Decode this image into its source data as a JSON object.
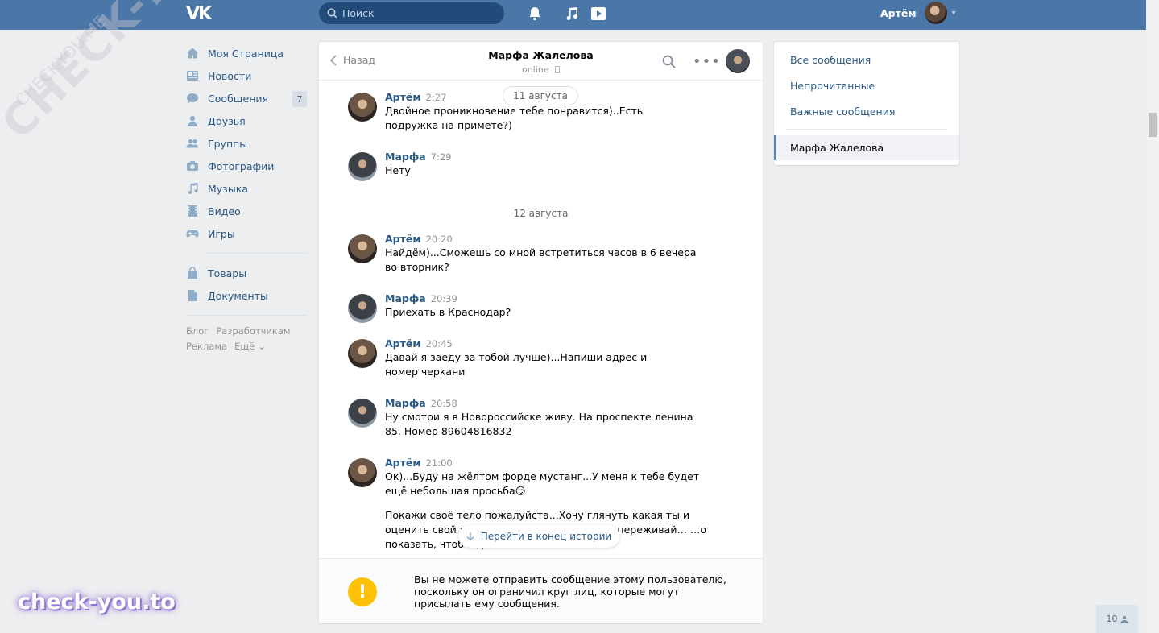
{
  "header": {
    "logo": "VK",
    "search_placeholder": "Поиск",
    "user_name": "Артём"
  },
  "nav": {
    "items": [
      {
        "label": "Моя Страница",
        "icon": "home-icon"
      },
      {
        "label": "Новости",
        "icon": "news-icon"
      },
      {
        "label": "Сообщения",
        "icon": "messages-icon",
        "count": "7"
      },
      {
        "label": "Друзья",
        "icon": "friends-icon"
      },
      {
        "label": "Группы",
        "icon": "groups-icon"
      },
      {
        "label": "Фотографии",
        "icon": "camera-icon"
      },
      {
        "label": "Музыка",
        "icon": "music-icon"
      },
      {
        "label": "Видео",
        "icon": "video-icon"
      },
      {
        "label": "Игры",
        "icon": "gamepad-icon"
      }
    ],
    "extra": [
      {
        "label": "Товары",
        "icon": "bag-icon"
      },
      {
        "label": "Документы",
        "icon": "document-icon"
      }
    ],
    "footer": {
      "blog": "Блог",
      "developers": "Разработчикам",
      "ads": "Реклама",
      "more": "Ещё"
    }
  },
  "chat": {
    "back_label": "Назад",
    "peer_name": "Марфа Жалелова",
    "peer_status": "online",
    "dates": [
      "11 августа",
      "12 августа"
    ],
    "messages": [
      {
        "author": "Артём",
        "time": "2:27",
        "text": "Двойное проникновение тебе понравится)..Есть подружка на примете?)"
      },
      {
        "author": "Марфа",
        "time": "7:29",
        "text": "Нету"
      },
      {
        "author": "Артём",
        "time": "20:20",
        "text": "Найдём)...Сможешь со мной встретиться часов в 6 вечера во вторник?"
      },
      {
        "author": "Марфа",
        "time": "20:39",
        "text": "Приехать в Краснодар?"
      },
      {
        "author": "Артём",
        "time": "20:45",
        "text": "Давай я заеду за тобой лучше)...Напиши адрес и номер черкани"
      },
      {
        "author": "Марфа",
        "time": "20:58",
        "text": "Ну смотри я в Новороссийске живу. На проспекте ленина 85. Номер 89604816832"
      },
      {
        "author": "Артём",
        "time": "21:00",
        "text": "Ок)...Буду на жёлтом форде мустанг...У меня к тебе будет ещё небольшая просьба😏",
        "text2": "Покажи своё тело пожалуйста...Хочу глянуть какая ты и оценить свой в… …льно!...В этом плане не переживай… …о показать, чтоб и для"
      }
    ],
    "jump_label": "Перейти в конец истории",
    "warning": "Вы не можете отправить сообщение этому пользователю, поскольку он ограничил круг лиц, которые могут присылать ему сообщения."
  },
  "right_menu": {
    "all": "Все сообщения",
    "unread": "Непрочитанные",
    "important": "Важные сообщения",
    "active_dialog": "Марфа Жалелова"
  },
  "online_badge": "10",
  "watermarks": {
    "diagonal": "CHECK-YOU.ME",
    "logo": "check-you.to"
  },
  "colors": {
    "header": "#4a76a8",
    "link": "#2a5885",
    "warning": "#ffc107"
  }
}
